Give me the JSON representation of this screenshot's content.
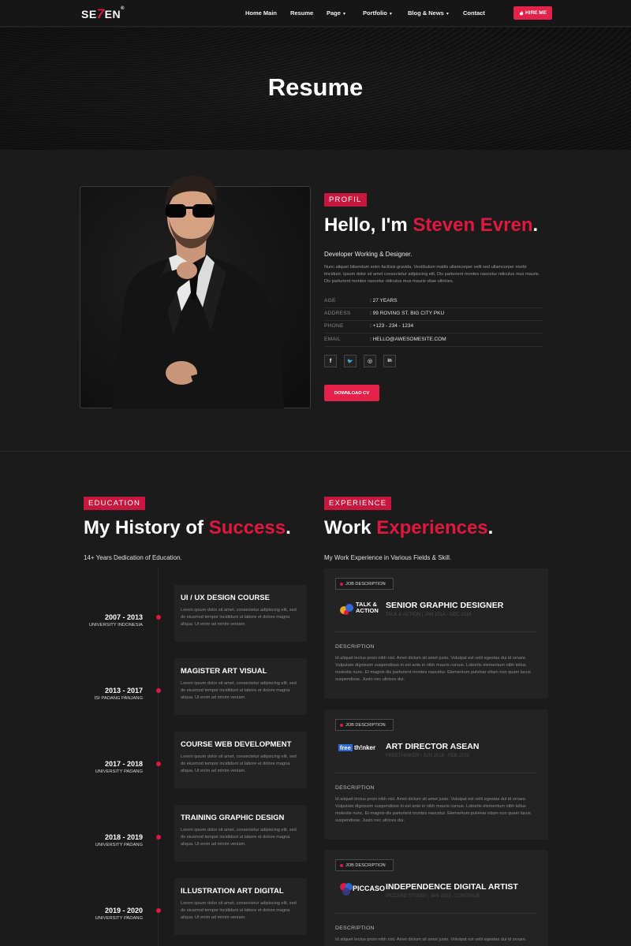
{
  "nav": {
    "logo_prefix": "SE",
    "logo_seven": "7",
    "logo_suffix": "EN",
    "logo_mark": "®",
    "items": [
      {
        "label": "Home Main",
        "dropdown": false
      },
      {
        "label": "Resume",
        "dropdown": false
      },
      {
        "label": "Page",
        "dropdown": true
      },
      {
        "label": "Portfolio",
        "dropdown": true
      },
      {
        "label": "Blog & News",
        "dropdown": true
      },
      {
        "label": "Contact",
        "dropdown": false
      }
    ],
    "caret": "▾",
    "hire_icon": "fire-icon",
    "hire_label": "HIRE ME"
  },
  "hero": {
    "title": "Resume"
  },
  "profile": {
    "tag": "PROFIL",
    "greeting": "Hello, I'm ",
    "name": "Steven Evren",
    "dot": ".",
    "role": "Developer Working & Designer.",
    "bio": "Nunc aliquet bibendum enim facilisis gravida. Vestibulum mattis ullamcorper velit sed ullamcorper morbi tincidunt. Ipsum dolor sit amet consectetur adipiscing elit. Dis parturient montes nascetur ridiculus mus mauris. Dis parturient montes nascetur ridiculus mus mauris vitae ultricies.",
    "info": [
      {
        "key": "AGE",
        "value": ": 27 YEARS"
      },
      {
        "key": "ADDRESS",
        "value": ": 99 ROVING ST. BIG CITY PKU"
      },
      {
        "key": "PHONE",
        "value": ": +123 - 234 - 1234"
      },
      {
        "key": "EMAIL",
        "value": ": HELLO@AWESOMESITE.COM"
      }
    ],
    "socials": [
      {
        "icon": "facebook-icon",
        "glyph": "f"
      },
      {
        "icon": "twitter-icon",
        "glyph": "🐦"
      },
      {
        "icon": "instagram-icon",
        "glyph": "◎"
      },
      {
        "icon": "linkedin-icon",
        "glyph": "in"
      }
    ],
    "cv_label": "DOWNLOAD CV"
  },
  "education": {
    "tag": "EDUCATION",
    "title_plain": "My History of ",
    "title_accent": "Success",
    "dot": ".",
    "subtitle": "14+ Years Dedication of Education.",
    "items": [
      {
        "years": "2007 - 2013",
        "school": "UNIVERSITY INDONESIA",
        "title": "UI / UX DESIGN COURSE",
        "desc": "Lorem ipsum dolor sit amet, consectetur adipiscing elit, sed do eiusmod tempor incididunt ut labore et dolore magna aliqua. Ut enim ad minim veniam."
      },
      {
        "years": "2013 - 2017",
        "school": "ISI PADANG PANJANG",
        "title": "MAGISTER ART VISUAL",
        "desc": "Lorem ipsum dolor sit amet, consectetur adipiscing elit, sed do eiusmod tempor incididunt ut labore et dolore magna aliqua. Ut enim ad minim veniam."
      },
      {
        "years": "2017 - 2018",
        "school": "UNIVERSITY PADANG",
        "title": "COURSE WEB DEVELOPMENT",
        "desc": "Lorem ipsum dolor sit amet, consectetur adipiscing elit, sed do eiusmod tempor incididunt ut labore et dolore magna aliqua. Ut enim ad minim veniam."
      },
      {
        "years": "2018 - 2019",
        "school": "UNIVERSITY PADANG",
        "title": "TRAINING GRAPHIC DESIGN",
        "desc": "Lorem ipsum dolor sit amet, consectetur adipiscing elit, sed do eiusmod tempor incididunt ut labore et dolore magna aliqua. Ut enim ad minim veniam."
      },
      {
        "years": "2019 - 2020",
        "school": "UNIVERSITY PADANG",
        "title": "ILLUSTRATION ART DIGITAL",
        "desc": "Lorem ipsum dolor sit amet, consectetur adipiscing elit, sed do eiusmod tempor incididunt ut labore et dolore magna aliqua. Ut enim ad minim veniam."
      }
    ]
  },
  "experience": {
    "tag": "EXPERIENCE",
    "title_plain": "Work ",
    "title_accent": "Experiences",
    "dot": ".",
    "subtitle": "My Work Experience in Various Fields & Skill.",
    "items": [
      {
        "badge": "JOB DESCRIPTION",
        "logo": "TALK & ACTION",
        "title": "SENIOR GRAPHIC DESIGNER",
        "meta": "TALK & ACTION | JAN 2014 - DEC 2016",
        "desc_label": "DESCRIPTION",
        "desc": "Id aliquet lectus proin nibh nisl. Amet dictum sit amet justo. Volutpat est velit egestas dui id ornare. Vulputate dignissim suspendisse in est ante in nibh mauris cursus. Lobortis elementum nibh tellus molestie nunc. Et magnis dis parturient montes nascetur. Elementum pulvinar etiam non quam lacus suspendisse. Justo nec ultrices dui."
      },
      {
        "badge": "JOB DESCRIPTION",
        "logo_a": "free",
        "logo_b": "th!nker",
        "title": "ART DIRECTOR ASEAN",
        "meta": "FREETHINKER | JUN 2016 - FEB 2020",
        "desc_label": "DESCRIPTION",
        "desc": "Id aliquet lectus proin nibh nisl. Amet dictum sit amet justo. Volutpat est velit egestas dui id ornare. Vulputate dignissim suspendisse in est ante in nibh mauris cursus. Lobortis elementum nibh tellus molestie nunc. Et magnis dis parturient montes nascetur. Elementum pulvinar etiam non quam lacus suspendisse. Justo nec ultrices dui."
      },
      {
        "badge": "JOB DESCRIPTION",
        "logo": "PICCASO",
        "title": "INDEPENDENCE DIGITAL ARTIST",
        "meta": "PICCASO STUDIO | JAN 2022 - CONTINUE",
        "desc_label": "DESCRIPTION",
        "desc": "Id aliquet lectus proin nibh nisl. Amet dictum sit amet justo. Volutpat est velit egestas dui id ornare."
      }
    ]
  },
  "colors": {
    "accent": "#e0183f",
    "button": "#e3214a",
    "background": "#1b1b1b",
    "card": "#232323"
  }
}
